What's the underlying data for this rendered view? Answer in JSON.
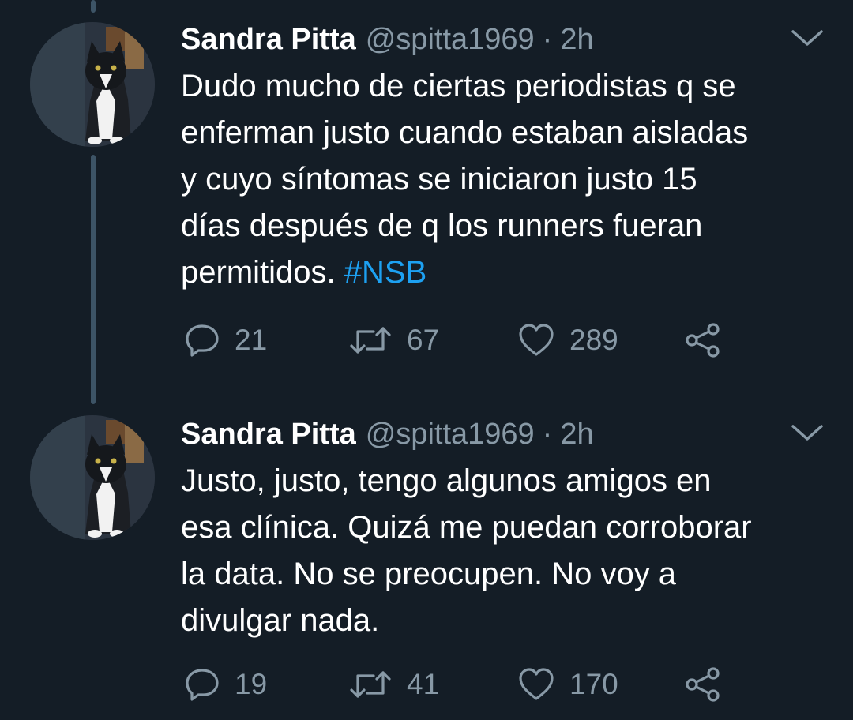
{
  "colors": {
    "background": "#141d26",
    "text_primary": "#ffffff",
    "text_secondary": "#8899a6",
    "link": "#1da1f2",
    "thread_line": "#3d5466"
  },
  "icons": {
    "reply": "reply-icon",
    "retweet": "retweet-icon",
    "like": "heart-icon",
    "share": "share-icon",
    "menu": "chevron-down-icon"
  },
  "tweets": [
    {
      "author": {
        "display_name": "Sandra Pitta",
        "handle": "@spitta1969"
      },
      "separator": "·",
      "time": "2h",
      "text_lines": [
        "Dudo mucho de ciertas periodistas q se",
        "enferman justo cuando estaban aisladas",
        "y cuyo síntomas se iniciaron justo 15",
        "días después de q los runners fueran"
      ],
      "last_line_text": "permitidos.",
      "hashtag": "#NSB",
      "stats": {
        "replies": "21",
        "retweets": "67",
        "likes": "289"
      }
    },
    {
      "author": {
        "display_name": "Sandra Pitta",
        "handle": "@spitta1969"
      },
      "separator": "·",
      "time": "2h",
      "text_lines": [
        "Justo, justo, tengo algunos amigos en",
        "esa clínica. Quizá me puedan corroborar",
        "la data. No se preocupen. No voy a",
        "divulgar nada."
      ],
      "stats": {
        "replies": "19",
        "retweets": "41",
        "likes": "170"
      }
    }
  ]
}
